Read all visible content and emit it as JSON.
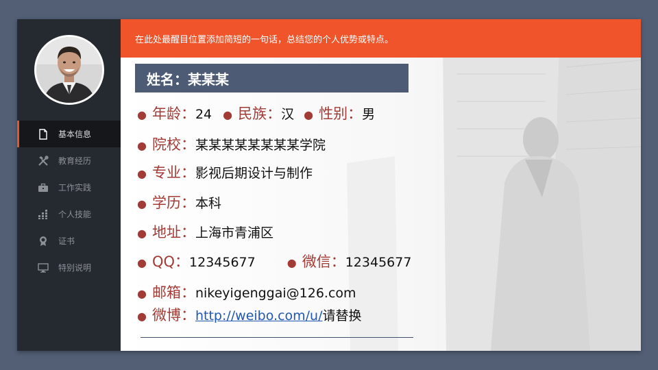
{
  "banner": {
    "text": "在此处最醒目位置添加简短的一句话，总结您的个人优势或特点。"
  },
  "sidebar": {
    "items": [
      {
        "label": "基本信息",
        "icon": "document-icon",
        "active": true
      },
      {
        "label": "教育经历",
        "icon": "tools-icon",
        "active": false
      },
      {
        "label": "工作实践",
        "icon": "briefcase-icon",
        "active": false
      },
      {
        "label": "个人技能",
        "icon": "bar-chart-icon",
        "active": false
      },
      {
        "label": "证书",
        "icon": "award-icon",
        "active": false
      },
      {
        "label": "特别说明",
        "icon": "monitor-icon",
        "active": false
      }
    ]
  },
  "profile": {
    "name_label": "姓名：",
    "name_value": "某某某",
    "age_label": "年龄：",
    "age_value": "24",
    "ethnicity_label": "民族：",
    "ethnicity_value": "汉",
    "gender_label": "性别：",
    "gender_value": "男",
    "school_label": "院校：",
    "school_value": "某某某某某某某某学院",
    "major_label": "专业：",
    "major_value": "影视后期设计与制作",
    "degree_label": "学历：",
    "degree_value": "本科",
    "address_label": "地址：",
    "address_value": "上海市青浦区",
    "qq_label": "QQ：",
    "qq_value": "12345677",
    "wechat_label": "微信：",
    "wechat_value": "12345677",
    "email_label": "邮箱：",
    "email_value": "nikeyigenggai@126.com",
    "weibo_label": "微博：",
    "weibo_link": "http://weibo.com/u/",
    "weibo_suffix": "请替换"
  },
  "colors": {
    "background": "#525f75",
    "sidebar": "#252930",
    "accent": "#f0542a",
    "name_bar": "#4d5b75",
    "label": "#a23a35",
    "link": "#1f57b3"
  }
}
